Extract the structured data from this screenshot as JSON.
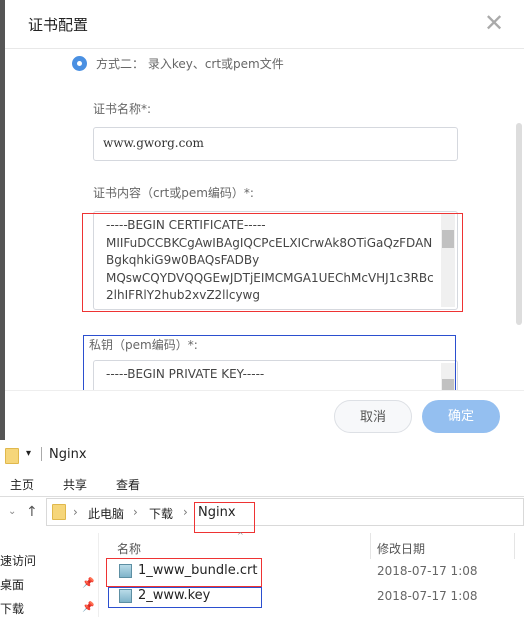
{
  "dialog": {
    "title": "证书配置",
    "close_icon": "close-icon",
    "option_label": "方式二： 录入key、crt或pem文件",
    "cert_name_label": "证书名称*:",
    "cert_name_value": "www.gworg.com",
    "cert_content_label": "证书内容（crt或pem编码）*:",
    "cert_content_lines": [
      "-----BEGIN CERTIFICATE-----",
      "MIIFuDCCBKCgAwIBAgIQCPcELXICrwAk8OTiGaQzFDAN",
      "BgkqhkiG9w0BAQsFADBy",
      "MQswCQYDVQQGEwJDTjEIMCMGA1UEChMcVHJ1c3RBc",
      "2lhIFRlY2hub2xvZ2llcywg"
    ],
    "private_key_label": "私钥（pem编码）*:",
    "private_key_lines": [
      "-----BEGIN PRIVATE KEY-----"
    ],
    "cancel_label": "取消",
    "confirm_label": "确定",
    "accent_color": "#4a90e2",
    "confirm_color": "#94bff0"
  },
  "explorer": {
    "title": "Nginx",
    "ribbon_tabs": [
      "主页",
      "共享",
      "查看"
    ],
    "breadcrumb": [
      "此电脑",
      "下载",
      "Nginx"
    ],
    "columns": {
      "name": "名称",
      "modified": "修改日期"
    },
    "nav_items": [
      "速访问",
      "桌面",
      "下载"
    ],
    "files": [
      {
        "name": "1_www_bundle.crt",
        "modified": "2018-07-17 1:08"
      },
      {
        "name": "2_www.key",
        "modified": "2018-07-17 1:08"
      }
    ]
  }
}
